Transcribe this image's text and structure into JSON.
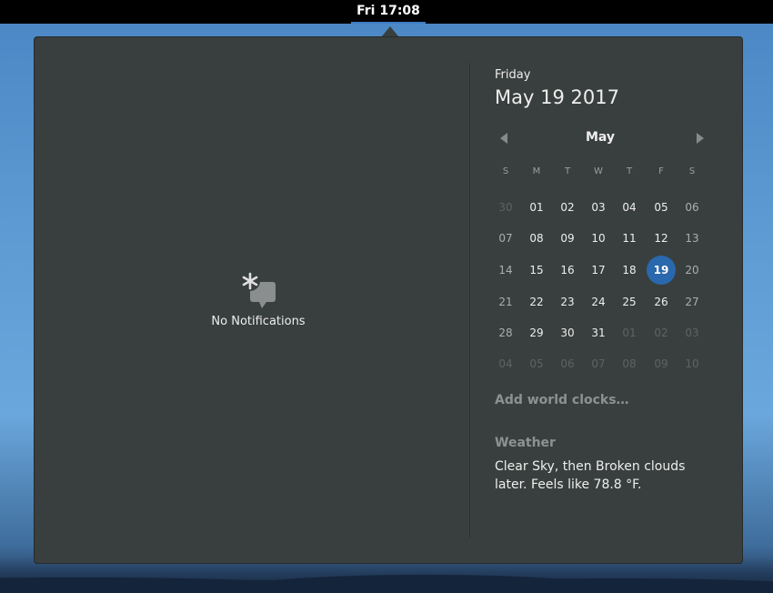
{
  "topbar": {
    "clock_label": "Fri 17:08"
  },
  "notifications": {
    "empty_label": "No Notifications"
  },
  "date": {
    "day_name": "Friday",
    "full_date": "May 19 2017"
  },
  "calendar": {
    "month": "May",
    "weekdays": [
      "S",
      "M",
      "T",
      "W",
      "T",
      "F",
      "S"
    ],
    "weeks": [
      [
        {
          "d": "30",
          "o": 1
        },
        {
          "d": "01"
        },
        {
          "d": "02"
        },
        {
          "d": "03"
        },
        {
          "d": "04"
        },
        {
          "d": "05"
        },
        {
          "d": "06"
        }
      ],
      [
        {
          "d": "07"
        },
        {
          "d": "08"
        },
        {
          "d": "09"
        },
        {
          "d": "10"
        },
        {
          "d": "11"
        },
        {
          "d": "12"
        },
        {
          "d": "13"
        }
      ],
      [
        {
          "d": "14"
        },
        {
          "d": "15"
        },
        {
          "d": "16"
        },
        {
          "d": "17"
        },
        {
          "d": "18"
        },
        {
          "d": "19",
          "t": 1
        },
        {
          "d": "20"
        }
      ],
      [
        {
          "d": "21"
        },
        {
          "d": "22"
        },
        {
          "d": "23"
        },
        {
          "d": "24"
        },
        {
          "d": "25"
        },
        {
          "d": "26"
        },
        {
          "d": "27"
        }
      ],
      [
        {
          "d": "28"
        },
        {
          "d": "29"
        },
        {
          "d": "30"
        },
        {
          "d": "31"
        },
        {
          "d": "01",
          "o": 1
        },
        {
          "d": "02",
          "o": 1
        },
        {
          "d": "03",
          "o": 1
        }
      ],
      [
        {
          "d": "04",
          "o": 1
        },
        {
          "d": "05",
          "o": 1
        },
        {
          "d": "06",
          "o": 1
        },
        {
          "d": "07",
          "o": 1
        },
        {
          "d": "08",
          "o": 1
        },
        {
          "d": "09",
          "o": 1
        },
        {
          "d": "10",
          "o": 1
        }
      ]
    ]
  },
  "world_clocks": {
    "label": "Add world clocks…"
  },
  "weather": {
    "title": "Weather",
    "summary": "Clear Sky, then Broken clouds later. Feels like 78.8 °F."
  },
  "colors": {
    "accent": "#2a68ad",
    "panel": "#393f3f",
    "topbar": "#000000"
  }
}
